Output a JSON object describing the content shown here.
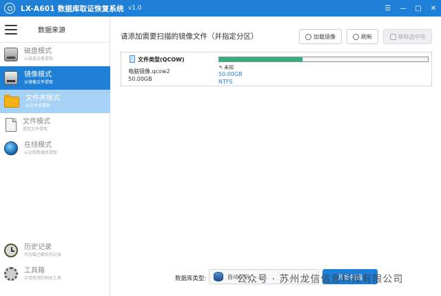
{
  "titlebar": {
    "title": "LX-A601 数据库取证恢复系统",
    "version": "v1.0",
    "controls": [
      "☰",
      "—",
      "□",
      "✕"
    ]
  },
  "sidebar": {
    "header_title": "数据来源",
    "items": [
      {
        "label": "磁盘模式",
        "sub": "从磁盘设备提取",
        "icon": "disk-icon"
      },
      {
        "label": "镜像模式",
        "sub": "从镜像文件提取",
        "icon": "image-drive-icon"
      },
      {
        "label": "文件夹模式",
        "sub": "从文件夹提取",
        "icon": "folder-icon"
      },
      {
        "label": "文件模式",
        "sub": "提取文件提取",
        "icon": "file-icon"
      },
      {
        "label": "在线模式",
        "sub": "从远程数据库提取",
        "icon": "globe-icon"
      }
    ],
    "bottom_items": [
      {
        "label": "历史记录",
        "sub": "可加载已解析的记录",
        "icon": "history-icon"
      },
      {
        "label": "工具箱",
        "sub": "实用常用的相关工具",
        "icon": "toolbox-icon"
      }
    ]
  },
  "main": {
    "title": "请添加需要扫描的镜像文件（并指定分区）",
    "toolbar": {
      "load_label": "加载镜像",
      "refresh_label": "刷新",
      "remove_label": "移除选中项"
    },
    "file": {
      "type_label": "文件类型(QCOW)",
      "name": "电脑镜像.qcow2",
      "size": "50.00GB",
      "partition": {
        "name": "↰ 未知",
        "size": "50.00GB",
        "fs": "NTFS",
        "usage_fraction": 0.4
      }
    },
    "bottom": {
      "db_label": "数据库类型:",
      "db_value": "自动识别",
      "start_label": "开始扫描",
      "watermark": "公众号 · 苏州龙信信息科技有限公司"
    }
  },
  "colors": {
    "accent": "#1e7fd6",
    "active_light": "#a8d2f5",
    "progress": "#2fb27a"
  }
}
